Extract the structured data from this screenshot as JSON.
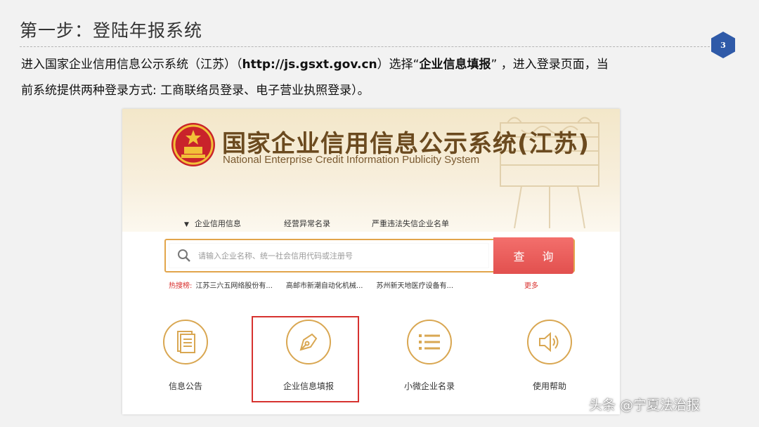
{
  "slide": {
    "title": "第一步：登陆年报系统",
    "page_number": "3",
    "desc_part1": "进入国家企业信用信息公示系统（江苏）（",
    "desc_url": "http://js.gsxt.gov.cn",
    "desc_part2": "）选择“",
    "desc_bold": "企业信息填报",
    "desc_part3": "” ，进入登录页面，当",
    "desc_line2": "前系统提供两种登录方式: 工商联络员登录、电子营业执照登录）。"
  },
  "site": {
    "title": "国家企业信用信息公示系统(江苏)",
    "subtitle": "National Enterprise Credit Information Publicity System",
    "nav": [
      "企业信用信息",
      "经营异常名录",
      "严重违法失信企业名单"
    ],
    "search": {
      "placeholder": "请输入企业名称、统一社会信用代码或注册号",
      "button": "查 询"
    },
    "hot": {
      "label": "热搜榜:",
      "items": [
        "江苏三六五网络股份有...",
        "高邮市新潮自动化机械...",
        "苏州新天地医疗设备有..."
      ],
      "more": "更多"
    },
    "functions": [
      {
        "label": "信息公告",
        "icon": "document-icon"
      },
      {
        "label": "企业信息填报",
        "icon": "pen-nib-icon"
      },
      {
        "label": "小微企业名录",
        "icon": "list-icon"
      },
      {
        "label": "使用帮助",
        "icon": "speaker-icon"
      }
    ],
    "highlighted_function": "企业信息填报"
  },
  "watermark": "头条 @宁夏法治报",
  "colors": {
    "accent_gold": "#d9a752",
    "search_red": "#e2504e",
    "highlight_red": "#d6322f",
    "title_brown": "#6b4a1f",
    "badge_blue": "#2f5aa8"
  }
}
